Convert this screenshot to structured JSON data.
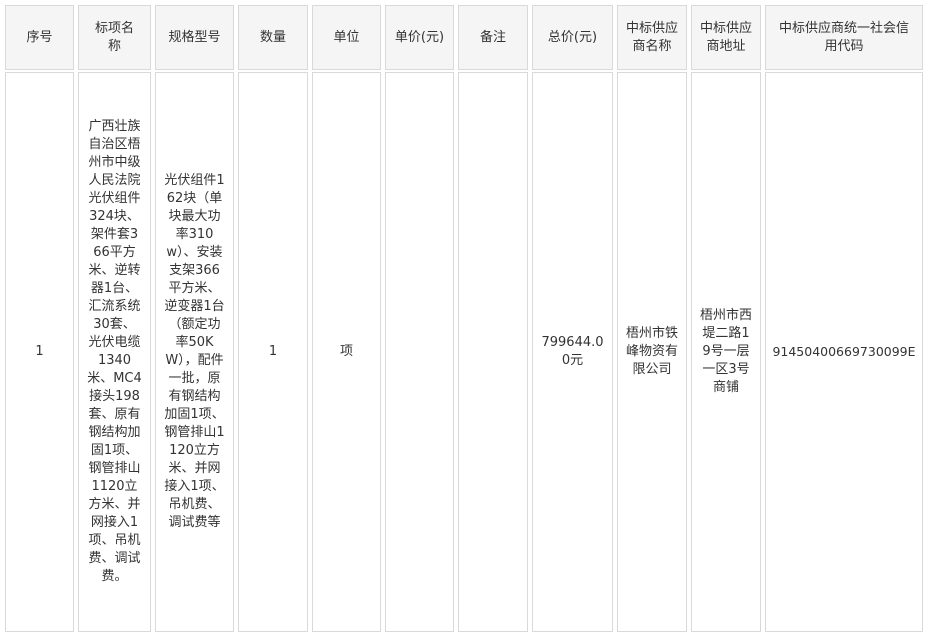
{
  "table": {
    "headers": [
      "序号",
      "标项名称",
      "规格型号",
      "数量",
      "单位",
      "单价(元)",
      "备注",
      "总价(元)",
      "中标供应商名称",
      "中标供应商地址",
      "中标供应商统一社会信用代码"
    ],
    "rows": [
      {
        "index": "1",
        "item_name": "广西壮族自治区梧州市中级人民法院光伏组件324块、架件套366平方米、逆转器1台、汇流系统30套、光伏电缆1340米、MC4接头198套、原有钢结构加固1项、钢管排山1120立方米、并网接入1项、吊机费、调试费。",
        "spec": "光伏组件162块（单块最大功率310w）、安装支架366平方米、逆变器1台（额定功率50KW），配件一批，原有钢结构加固1项、钢管排山1120立方米、并网接入1项、吊机费、调试费等",
        "quantity": "1",
        "unit": "项",
        "unit_price": "",
        "remark": "",
        "total_price": "799644.00元",
        "supplier_name": "梧州市铁峰物资有限公司",
        "supplier_address": "梧州市西堤二路19号一层一区3号商铺",
        "credit_code": "91450400669730099E"
      }
    ]
  }
}
